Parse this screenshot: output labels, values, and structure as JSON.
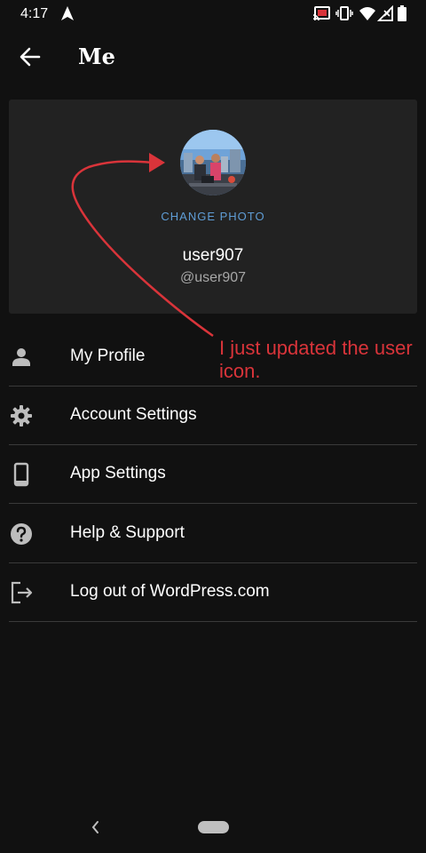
{
  "status_bar": {
    "time": "4:17",
    "icons": [
      "navigation-icon",
      "cast-icon",
      "vibrate-icon",
      "wifi-icon",
      "signal-icon",
      "battery-icon"
    ]
  },
  "app_bar": {
    "back_icon": "arrow-left-icon",
    "title": "Me"
  },
  "profile": {
    "change_photo_label": "CHANGE PHOTO",
    "display_name": "user907",
    "username": "@user907"
  },
  "menu": {
    "items": [
      {
        "label": "My Profile",
        "icon": "person-icon"
      },
      {
        "label": "Account Settings",
        "icon": "gear-icon"
      },
      {
        "label": "App Settings",
        "icon": "phone-icon"
      },
      {
        "label": "Help & Support",
        "icon": "help-icon"
      },
      {
        "label": "Log out of WordPress.com",
        "icon": "logout-icon"
      }
    ]
  },
  "annotation": {
    "text": "I just updated the user icon.",
    "color": "#d9343a"
  },
  "colors": {
    "background": "#111111",
    "card": "#222222",
    "accent": "#5f9dd6",
    "divider": "#3a3a3a"
  }
}
